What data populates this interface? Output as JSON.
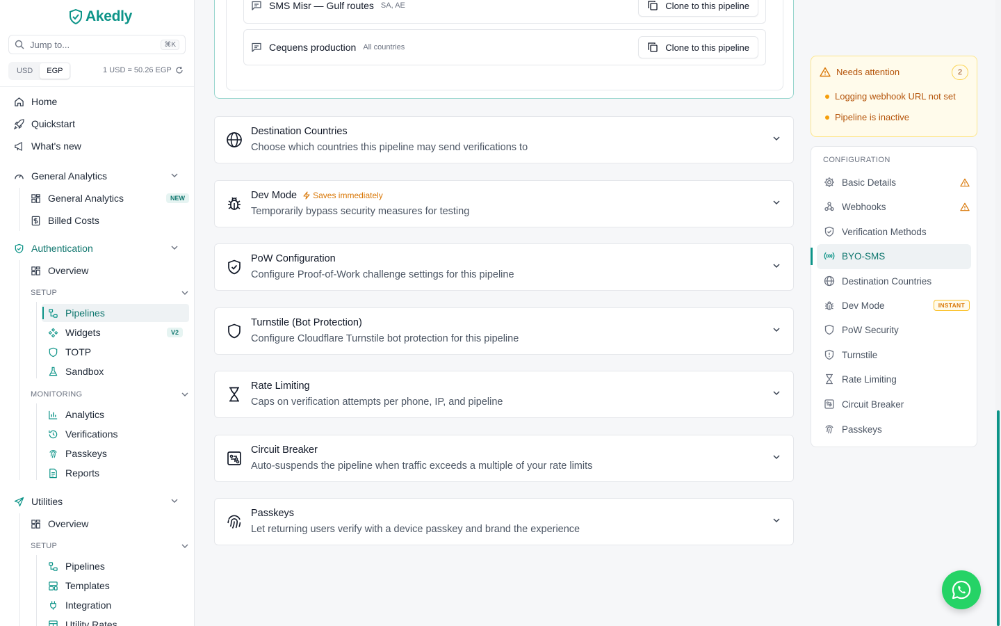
{
  "app": {
    "logo_text": "Akedly",
    "brand_color": "#0d9488"
  },
  "search": {
    "placeholder": "Jump to...",
    "shortcut": "⌘K"
  },
  "currency": {
    "options": [
      "USD",
      "EGP"
    ],
    "selected": "EGP",
    "rate_text": "1 USD = 50.26 EGP"
  },
  "sidebar": {
    "top_items": [
      {
        "label": "Home",
        "icon": "home-icon"
      },
      {
        "label": "Quickstart",
        "icon": "rocket-icon"
      },
      {
        "label": "What's new",
        "icon": "megaphone-icon"
      }
    ],
    "general_analytics": {
      "label": "General Analytics",
      "items": [
        {
          "label": "General Analytics",
          "badge": "NEW"
        },
        {
          "label": "Billed Costs"
        }
      ]
    },
    "authentication": {
      "label": "Authentication",
      "overview": "Overview",
      "setup_label": "SETUP",
      "setup_items": [
        {
          "label": "Pipelines"
        },
        {
          "label": "Widgets",
          "badge": "V2"
        },
        {
          "label": "TOTP"
        },
        {
          "label": "Sandbox"
        }
      ],
      "monitoring_label": "MONITORING",
      "monitoring_items": [
        {
          "label": "Analytics"
        },
        {
          "label": "Verifications"
        },
        {
          "label": "Passkeys"
        },
        {
          "label": "Reports"
        }
      ]
    },
    "utilities": {
      "label": "Utilities",
      "overview": "Overview",
      "setup_label": "SETUP",
      "setup_items": [
        {
          "label": "Pipelines"
        },
        {
          "label": "Templates"
        },
        {
          "label": "Integration"
        },
        {
          "label": "Utility Rates"
        }
      ]
    }
  },
  "byo_sms": {
    "routes": [
      {
        "name": "SMS Misr — Gulf routes",
        "scope": "SA, AE",
        "button": "Clone to this pipeline"
      },
      {
        "name": "Cequens production",
        "scope": "All countries",
        "button": "Clone to this pipeline"
      }
    ]
  },
  "sections": [
    {
      "title": "Destination Countries",
      "subtitle": "Choose which countries this pipeline may send verifications to",
      "icon": "globe-icon"
    },
    {
      "title": "Dev Mode",
      "tag": "Saves immediately",
      "subtitle": "Temporarily bypass security measures for testing",
      "icon": "bug-icon"
    },
    {
      "title": "PoW Configuration",
      "subtitle": "Configure Proof-of-Work challenge settings for this pipeline",
      "icon": "shield-check-icon"
    },
    {
      "title": "Turnstile (Bot Protection)",
      "subtitle": "Configure Cloudflare Turnstile bot protection for this pipeline",
      "icon": "shield-icon"
    },
    {
      "title": "Rate Limiting",
      "subtitle": "Caps on verification attempts per phone, IP, and pipeline",
      "icon": "hourglass-icon"
    },
    {
      "title": "Circuit Breaker",
      "subtitle": "Auto-suspends the pipeline when traffic exceeds a multiple of your rate limits",
      "icon": "circuit-board-icon"
    },
    {
      "title": "Passkeys",
      "subtitle": "Let returning users verify with a device passkey and brand the experience",
      "icon": "fingerprint-icon"
    }
  ],
  "attention": {
    "title": "Needs attention",
    "count": "2",
    "items": [
      "Logging webhook URL not set",
      "Pipeline is inactive"
    ]
  },
  "configuration": {
    "heading": "CONFIGURATION",
    "items": [
      {
        "label": "Basic Details",
        "icon": "gear-icon",
        "warning": true
      },
      {
        "label": "Webhooks",
        "icon": "webhook-icon",
        "warning": true
      },
      {
        "label": "Verification Methods",
        "icon": "shield-check-icon"
      },
      {
        "label": "BYO-SMS",
        "icon": "radio-icon",
        "active": true
      },
      {
        "label": "Destination Countries",
        "icon": "globe-icon"
      },
      {
        "label": "Dev Mode",
        "icon": "bug-icon",
        "badge": "INSTANT"
      },
      {
        "label": "PoW Security",
        "icon": "shield-icon"
      },
      {
        "label": "Turnstile",
        "icon": "shield-alert-icon"
      },
      {
        "label": "Rate Limiting",
        "icon": "hourglass-icon"
      },
      {
        "label": "Circuit Breaker",
        "icon": "circuit-board-icon"
      },
      {
        "label": "Passkeys",
        "icon": "fingerprint-icon"
      }
    ]
  }
}
